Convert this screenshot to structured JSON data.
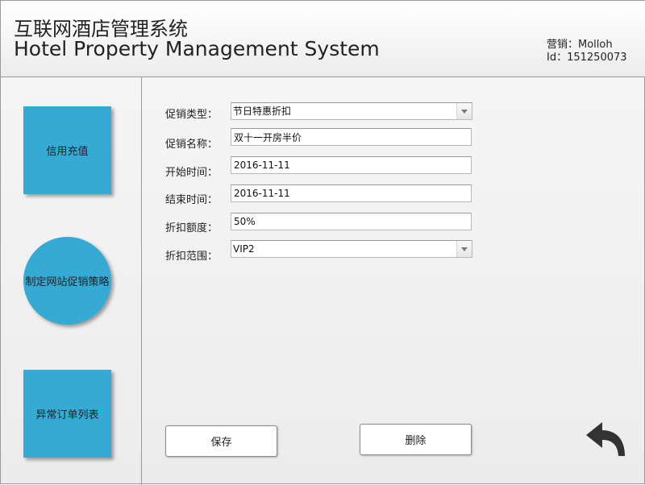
{
  "header": {
    "title_cn": "互联网酒店管理系统",
    "title_en": "Hotel Property Management System",
    "user_role": "营销：Molloh",
    "user_id": "Id：151250073"
  },
  "sidebar": {
    "items": [
      {
        "label": "信用充值"
      },
      {
        "label": "制定网站促销策略"
      },
      {
        "label": "异常订单列表"
      }
    ],
    "accent_color": "#34aad4"
  },
  "form": {
    "promo_type": {
      "label": "促销类型：",
      "value": "节日特惠折扣"
    },
    "promo_name": {
      "label": "促销名称：",
      "value": "双十一开房半价"
    },
    "start_time": {
      "label": "开始时间：",
      "value": "2016-11-11"
    },
    "end_time": {
      "label": "结束时间：",
      "value": "2016-11-11"
    },
    "discount_amount": {
      "label": "折扣额度：",
      "value": "50%"
    },
    "discount_scope": {
      "label": "折扣范围：",
      "value": "VIP2"
    }
  },
  "actions": {
    "save_label": "保存",
    "delete_label": "删除",
    "back_icon": "back-arrow-icon"
  }
}
